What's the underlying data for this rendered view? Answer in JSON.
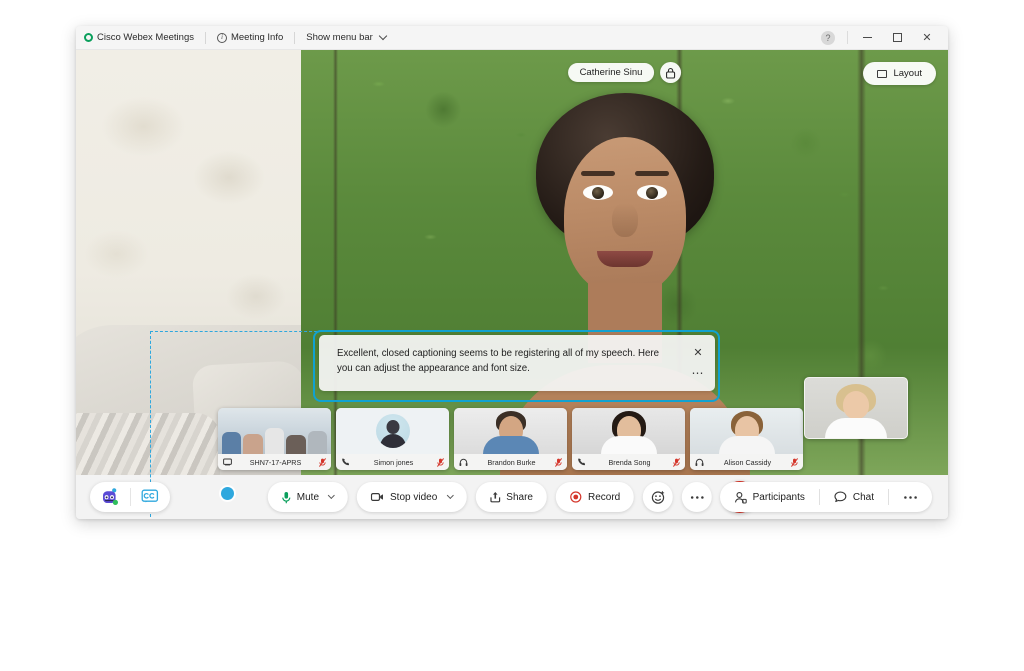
{
  "titlebar": {
    "app_name": "Cisco Webex Meetings",
    "meeting_info_label": "Meeting Info",
    "show_menu_bar_label": "Show menu bar",
    "icons": {
      "logo": "webex-logo-icon",
      "info": "info-circle-icon",
      "chevron": "chevron-down-icon",
      "feedback": "feedback-icon",
      "minimize": "minimize-icon",
      "maximize": "maximize-icon",
      "close": "close-icon"
    },
    "close_glyph": "✕"
  },
  "stage": {
    "active_speaker_name": "Catherine Sinu",
    "lock_icon": "lock-icon",
    "layout_label": "Layout",
    "layout_icon": "layout-grid-icon"
  },
  "caption": {
    "text": "Excellent, closed captioning seems to be registering all of my speech. Here you can adjust the appearance and font size.",
    "close_glyph": "✕",
    "more_glyph": "⋯",
    "highlight_color": "#11a2d1"
  },
  "filmstrip": {
    "tiles": [
      {
        "name": "SHN7-17-APRS",
        "device_icon": "video-device-icon",
        "muted": true,
        "kind": "room"
      },
      {
        "name": "Simon jones",
        "device_icon": "phone-icon",
        "muted": true,
        "kind": "avatar"
      },
      {
        "name": "Brandon Burke",
        "device_icon": "headset-icon",
        "muted": true,
        "kind": "portrait-male"
      },
      {
        "name": "Brenda Song",
        "device_icon": "phone-icon",
        "muted": true,
        "kind": "portrait-female-dark"
      },
      {
        "name": "Alison Cassidy",
        "device_icon": "headset-icon",
        "muted": true,
        "kind": "portrait-female-light"
      }
    ],
    "self_view_label": ""
  },
  "toolbar": {
    "mute_label": "Mute",
    "mute_icon": "microphone-icon",
    "stop_video_label": "Stop video",
    "stop_video_icon": "camera-icon",
    "share_label": "Share",
    "share_icon": "share-upload-icon",
    "record_label": "Record",
    "record_icon": "record-dot-icon",
    "reactions_icon": "emoji-smiley-icon",
    "more_icon": "more-horizontal-icon",
    "leave_icon": "close-icon",
    "leave_glyph": "✕",
    "participants_label": "Participants",
    "participants_icon": "participants-icon",
    "chat_label": "Chat",
    "chat_icon": "chat-bubble-icon",
    "right_more_icon": "more-horizontal-icon",
    "leave_color": "#d32f23",
    "mic_color": "#0a9f5c",
    "record_color": "#d4352a"
  },
  "assistant": {
    "bot_icon": "webex-assistant-bot-icon",
    "cc_icon": "closed-caption-icon",
    "callout_dot": "callout-anchor-dot"
  }
}
